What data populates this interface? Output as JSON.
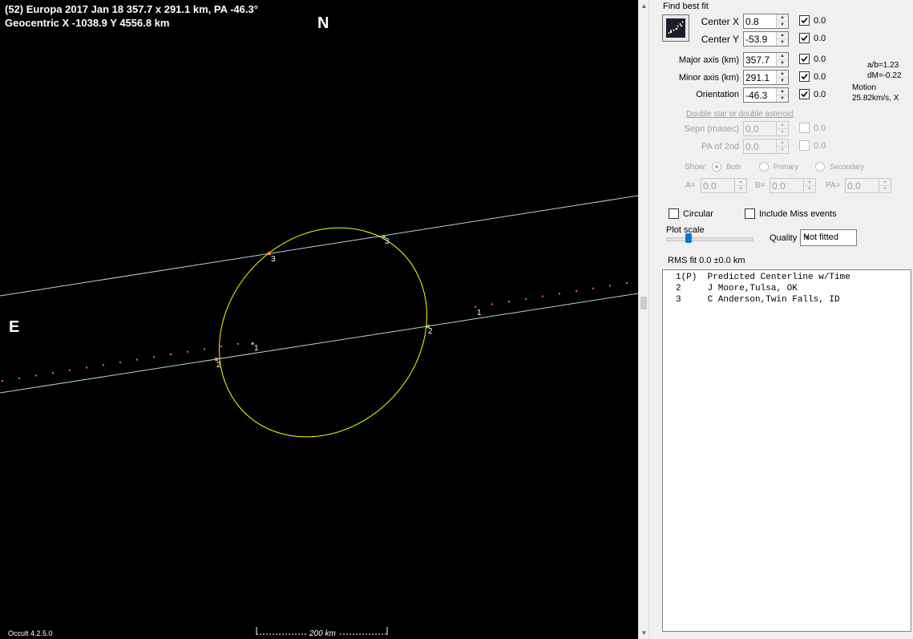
{
  "plot": {
    "title_line1": "(52) Europa  2017 Jan 18  357.7 x 291.1 km, PA -46.3°",
    "title_line2": "Geocentric  X  -1038.9  Y 4556.8 km",
    "north_label": "N",
    "east_label": "E",
    "version": "Occult 4.2.5.0",
    "scale_label": "200 km",
    "chord_labels": {
      "p1a": "1",
      "p1b": "1",
      "p2a": "2",
      "p2b": "2",
      "p3a": "3",
      "p3b": "3"
    },
    "colors": {
      "background": "#000000",
      "ellipse": "#ffff00",
      "chord": "#b4d2e6",
      "dots": "#ff5a78",
      "text": "#ffffff"
    }
  },
  "panel": {
    "find_best_fit": "Find best fit",
    "fit_button_icon": "fit-chart-icon",
    "center_x": {
      "label": "Center X",
      "value": "0.8",
      "checked": true,
      "extra": "0.0"
    },
    "center_y": {
      "label": "Center Y",
      "value": "-53.9",
      "checked": true,
      "extra": "0.0"
    },
    "major_axis": {
      "label": "Major axis (km)",
      "value": "357.7",
      "checked": true,
      "extra": "0.0"
    },
    "minor_axis": {
      "label": "Minor axis (km)",
      "value": "291.1",
      "checked": true,
      "extra": "0.0"
    },
    "orientation": {
      "label": "Orientation",
      "value": "-46.3",
      "checked": true,
      "extra": "0.0"
    },
    "ab_ratio": "a/b=1.23",
    "dm": "dM=-0.22",
    "motion_label": "Motion",
    "motion_value": "25.82km/s, X",
    "double_star_link": "Double star  or  double asteroid",
    "sepn": {
      "label": "Sepn (masec)",
      "value": "0.0",
      "extra": "0.0"
    },
    "pa2nd": {
      "label": "PA of 2nd",
      "value": "0.0",
      "extra": "0.0"
    },
    "show_label": "Show:",
    "show_options": {
      "both": "Both",
      "primary": "Primary",
      "secondary": "Secondary"
    },
    "a_label": "A=",
    "a_value": "0.0",
    "b_label": "B=",
    "b_value": "0.0",
    "pa_label": "PA=",
    "pa_value": "0.0",
    "circular_label": "Circular",
    "include_miss_label": "Include Miss events",
    "plot_scale_label": "Plot scale",
    "plot_scale_level": 0.26,
    "quality_label": "Quality",
    "quality_value": "Not fitted",
    "rms_fit": "RMS fit 0.0 ±0.0 km",
    "observers": [
      "1(P)  Predicted Centerline w/Time",
      "2     J Moore,Tulsa, OK",
      "3     C Anderson,Twin Falls, ID"
    ]
  }
}
